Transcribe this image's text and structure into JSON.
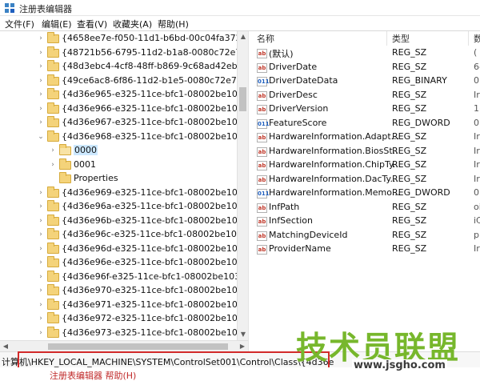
{
  "window": {
    "title": "注册表编辑器"
  },
  "menu": [
    "文件(F)",
    "编辑(E)",
    "查看(V)",
    "收藏夹(A)",
    "帮助(H)"
  ],
  "tree": {
    "nodes": [
      {
        "label": "{4658ee7e-f050-11d1-b6bd-00c04fa372a7}",
        "level": 0,
        "expander": "collapsed"
      },
      {
        "label": "{48721b56-6795-11d2-b1a8-0080c72e74a2}",
        "level": 0,
        "expander": "collapsed"
      },
      {
        "label": "{48d3ebc4-4cf8-48ff-b869-9c68ad42eb9f}",
        "level": 0,
        "expander": "collapsed"
      },
      {
        "label": "{49ce6ac8-6f86-11d2-b1e5-0080c72e74a2}",
        "level": 0,
        "expander": "collapsed"
      },
      {
        "label": "{4d36e965-e325-11ce-bfc1-08002be10318}",
        "level": 0,
        "expander": "collapsed"
      },
      {
        "label": "{4d36e966-e325-11ce-bfc1-08002be10318}",
        "level": 0,
        "expander": "collapsed"
      },
      {
        "label": "{4d36e967-e325-11ce-bfc1-08002be10318}",
        "level": 0,
        "expander": "collapsed"
      },
      {
        "label": "{4d36e968-e325-11ce-bfc1-08002be10318}",
        "level": 0,
        "expander": "expanded"
      },
      {
        "label": "0000",
        "level": 1,
        "expander": "collapsed",
        "selected": true
      },
      {
        "label": "0001",
        "level": 1,
        "expander": "collapsed"
      },
      {
        "label": "Properties",
        "level": 1,
        "expander": "none"
      },
      {
        "label": "{4d36e969-e325-11ce-bfc1-08002be10318}",
        "level": 0,
        "expander": "collapsed"
      },
      {
        "label": "{4d36e96a-e325-11ce-bfc1-08002be10318}",
        "level": 0,
        "expander": "collapsed"
      },
      {
        "label": "{4d36e96b-e325-11ce-bfc1-08002be10318}",
        "level": 0,
        "expander": "collapsed"
      },
      {
        "label": "{4d36e96c-e325-11ce-bfc1-08002be10318}",
        "level": 0,
        "expander": "collapsed"
      },
      {
        "label": "{4d36e96d-e325-11ce-bfc1-08002be10318}",
        "level": 0,
        "expander": "collapsed"
      },
      {
        "label": "{4d36e96e-e325-11ce-bfc1-08002be10318}",
        "level": 0,
        "expander": "collapsed"
      },
      {
        "label": "{4d36e96f-e325-11ce-bfc1-08002be10318}",
        "level": 0,
        "expander": "collapsed"
      },
      {
        "label": "{4d36e970-e325-11ce-bfc1-08002be10318}",
        "level": 0,
        "expander": "collapsed"
      },
      {
        "label": "{4d36e971-e325-11ce-bfc1-08002be10318}",
        "level": 0,
        "expander": "collapsed"
      },
      {
        "label": "{4d36e972-e325-11ce-bfc1-08002be10318}",
        "level": 0,
        "expander": "collapsed"
      },
      {
        "label": "{4d36e973-e325-11ce-bfc1-08002be10318}",
        "level": 0,
        "expander": "collapsed"
      },
      {
        "label": "{4d36e974-e325-11ce-bfc1-08002be10318}",
        "level": 0,
        "expander": "collapsed"
      },
      {
        "label": "{4d36e975-e325-11ce-bfc1-08002be10318}",
        "level": 0,
        "expander": "collapsed"
      }
    ]
  },
  "values": {
    "columns": {
      "name": "名称",
      "type": "类型",
      "data": "数"
    },
    "rows": [
      {
        "name": "(默认)",
        "type": "REG_SZ",
        "data": "(",
        "icon": "string-value-icon"
      },
      {
        "name": "DriverDate",
        "type": "REG_SZ",
        "data": "6-",
        "icon": "string-value-icon"
      },
      {
        "name": "DriverDateData",
        "type": "REG_BINARY",
        "data": "0",
        "icon": "binary-value-icon"
      },
      {
        "name": "DriverDesc",
        "type": "REG_SZ",
        "data": "Ir",
        "icon": "string-value-icon"
      },
      {
        "name": "DriverVersion",
        "type": "REG_SZ",
        "data": "1(",
        "icon": "string-value-icon"
      },
      {
        "name": "FeatureScore",
        "type": "REG_DWORD",
        "data": "0:",
        "icon": "binary-value-icon"
      },
      {
        "name": "HardwareInformation.Adapt...",
        "type": "REG_SZ",
        "data": "Ir",
        "icon": "string-value-icon"
      },
      {
        "name": "HardwareInformation.BiosSt...",
        "type": "REG_SZ",
        "data": "Ir",
        "icon": "string-value-icon"
      },
      {
        "name": "HardwareInformation.ChipTy...",
        "type": "REG_SZ",
        "data": "Ir",
        "icon": "string-value-icon"
      },
      {
        "name": "HardwareInformation.DacTy...",
        "type": "REG_SZ",
        "data": "Ir",
        "icon": "string-value-icon"
      },
      {
        "name": "HardwareInformation.Memo...",
        "type": "REG_DWORD",
        "data": "0:",
        "icon": "binary-value-icon"
      },
      {
        "name": "InfPath",
        "type": "REG_SZ",
        "data": "oi",
        "icon": "string-value-icon"
      },
      {
        "name": "InfSection",
        "type": "REG_SZ",
        "data": "iC",
        "icon": "string-value-icon"
      },
      {
        "name": "MatchingDeviceId",
        "type": "REG_SZ",
        "data": "p",
        "icon": "string-value-icon"
      },
      {
        "name": "ProviderName",
        "type": "REG_SZ",
        "data": "Ir",
        "icon": "string-value-icon"
      }
    ]
  },
  "status": {
    "path": "计算机\\HKEY_LOCAL_MACHINE\\SYSTEM\\ControlSet001\\Control\\Class\\{4d36e"
  },
  "bottom": {
    "text": "注册表编辑器   帮助(H)"
  },
  "watermark": {
    "logo": "技术员联盟",
    "url": "www.jsgho.com"
  },
  "colors": {
    "selection": "#cce8ff",
    "highlight_box": "#d22a2a",
    "folder": "#f4d37a",
    "watermark_green": "#77b72c"
  }
}
